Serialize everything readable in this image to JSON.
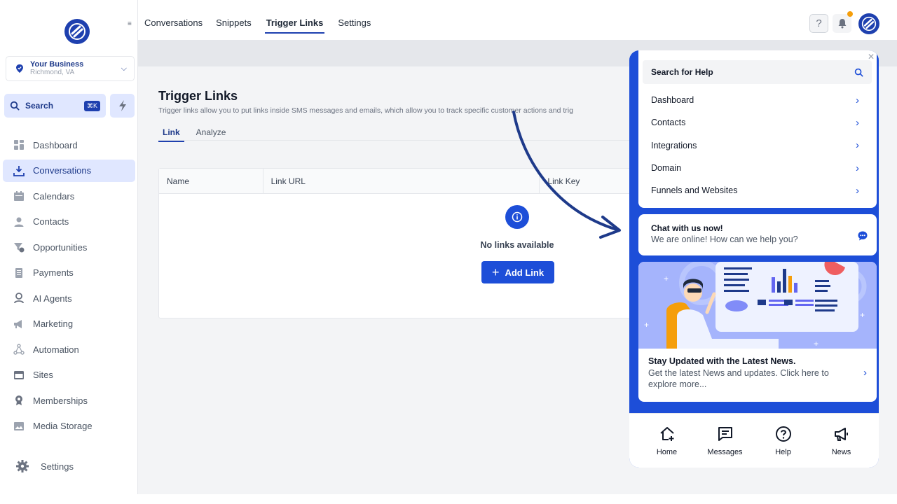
{
  "sidebar": {
    "business": {
      "name": "Your Business",
      "location": "Richmond, VA"
    },
    "search_label": "Search",
    "search_shortcut": "⌘K",
    "items": [
      {
        "label": "Dashboard",
        "icon": "dashboard-icon"
      },
      {
        "label": "Conversations",
        "icon": "conversations-icon",
        "active": true
      },
      {
        "label": "Calendars",
        "icon": "calendar-icon"
      },
      {
        "label": "Contacts",
        "icon": "contacts-icon"
      },
      {
        "label": "Opportunities",
        "icon": "opportunities-icon"
      },
      {
        "label": "Payments",
        "icon": "payments-icon"
      },
      {
        "label": "AI Agents",
        "icon": "ai-agents-icon"
      },
      {
        "label": "Marketing",
        "icon": "marketing-icon"
      },
      {
        "label": "Automation",
        "icon": "automation-icon"
      },
      {
        "label": "Sites",
        "icon": "sites-icon"
      },
      {
        "label": "Memberships",
        "icon": "memberships-icon"
      },
      {
        "label": "Media Storage",
        "icon": "media-storage-icon"
      }
    ],
    "settings_label": "Settings"
  },
  "topbar": {
    "tabs": [
      "Conversations",
      "Snippets",
      "Trigger Links",
      "Settings"
    ],
    "active_tab": "Trigger Links",
    "help_label": "?"
  },
  "main": {
    "title": "Trigger Links",
    "subtitle": "Trigger links allow you to put links inside SMS messages and emails, which allow you to track specific customer actions and trig",
    "tabs": [
      "Link",
      "Analyze"
    ],
    "active_tab": "Link",
    "columns": [
      "Name",
      "Link URL",
      "Link Key"
    ],
    "empty_text": "No links available",
    "add_label": "Add Link"
  },
  "widget": {
    "search_label": "Search for Help",
    "items": [
      "Dashboard",
      "Contacts",
      "Integrations",
      "Domain",
      "Funnels and Websites"
    ],
    "chat_title": "Chat with us now!",
    "chat_sub": "We are online! How can we help you?",
    "news_title": "Stay Updated with the Latest News.",
    "news_sub": "Get the latest News and updates. Click here to explore more...",
    "bottom_nav": [
      "Home",
      "Messages",
      "Help",
      "News"
    ]
  },
  "colors": {
    "brand": "#1d4ed8",
    "accent_dot": "#f59e0b",
    "active_bg": "#e0e7ff"
  }
}
